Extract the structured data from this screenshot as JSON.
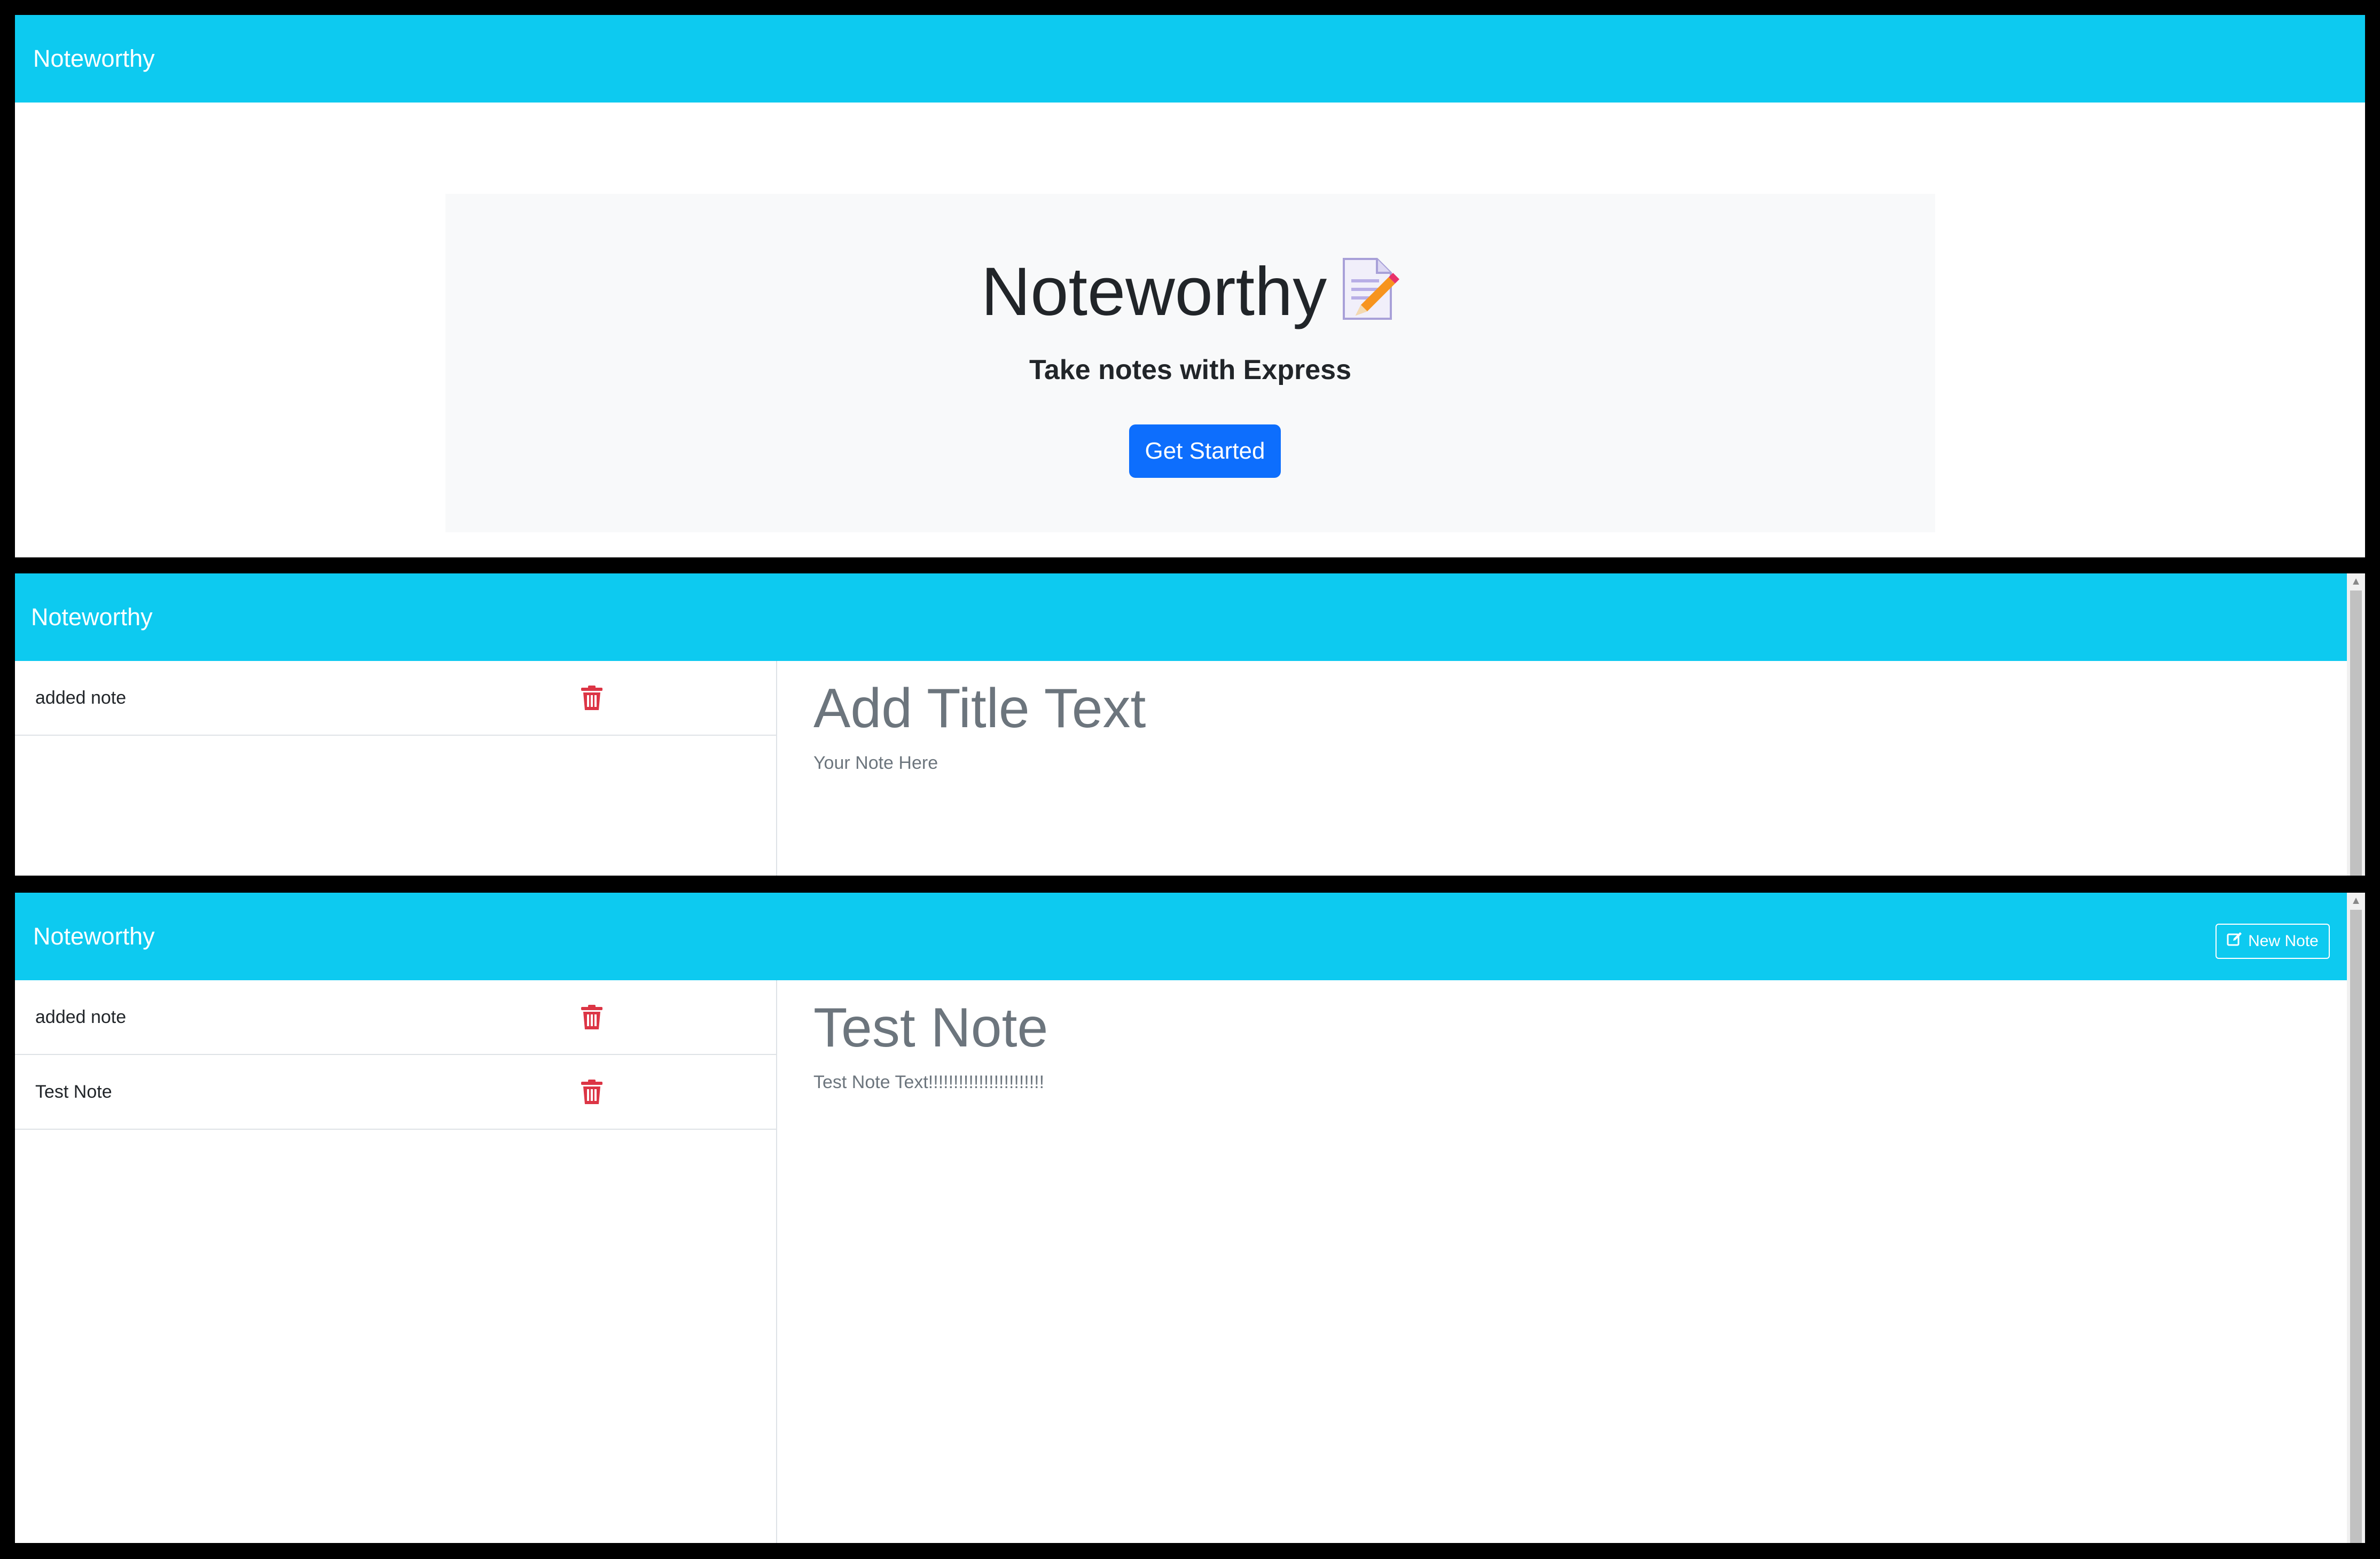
{
  "colors": {
    "navbar": "#0dcaf0",
    "primary_button": "#0d6efd",
    "danger_icon": "#dc3545",
    "jumbotron_bg": "#f8f9fa",
    "muted_text": "#6c757d"
  },
  "landing": {
    "brand": "Noteworthy",
    "hero_title": "Noteworthy",
    "hero_icon": "memo-icon",
    "subtitle": "Take notes with Express",
    "cta_label": "Get Started"
  },
  "notes_empty": {
    "brand": "Noteworthy",
    "notes": [
      {
        "title": "added note",
        "icon": "trash-icon"
      }
    ],
    "editor": {
      "title_placeholder": "Add Title Text",
      "body_placeholder": "Your Note Here"
    }
  },
  "notes_active": {
    "brand": "Noteworthy",
    "new_note_label": "New Note",
    "new_note_icon": "edit-icon",
    "notes": [
      {
        "title": "added note",
        "icon": "trash-icon"
      },
      {
        "title": "Test Note",
        "icon": "trash-icon"
      }
    ],
    "editor": {
      "title_value": "Test Note",
      "body_value": "Test Note Text!!!!!!!!!!!!!!!!!!!!!!!"
    }
  }
}
